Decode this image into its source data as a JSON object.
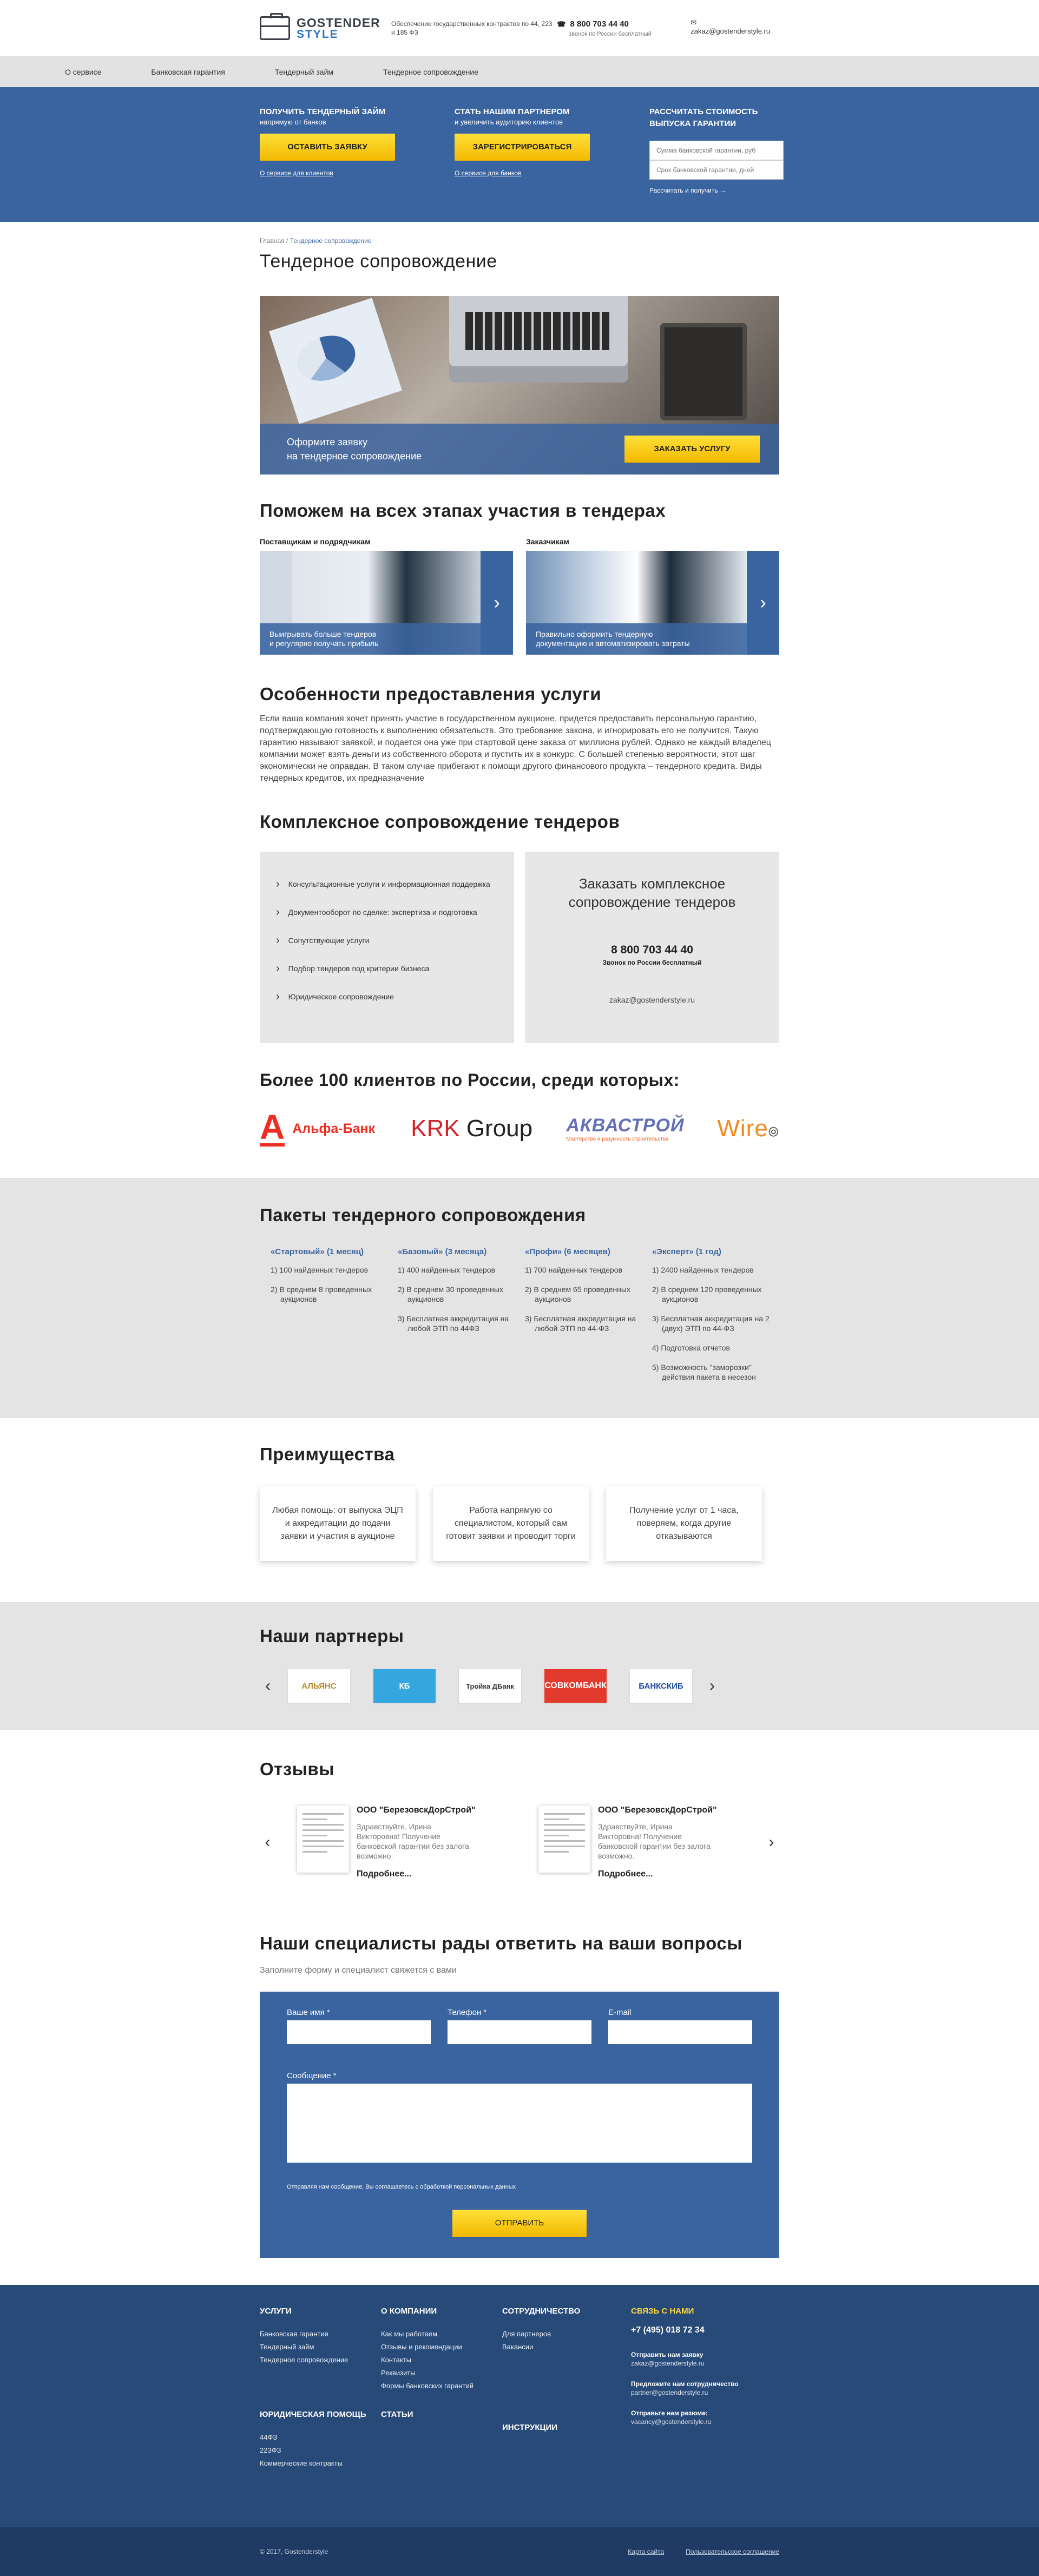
{
  "header": {
    "logo_top": "GOSTENDER",
    "logo_bottom": "STYLE",
    "desc": "Обеспечение государственных контрактов по 44, 223 и 185 ФЗ",
    "phone": "8 800 703 44 40",
    "phone_note": "звонок по России бесплатный",
    "email": "zakaz@gostenderstyle.ru"
  },
  "nav": [
    "О сервисе",
    "Банковская гарантия",
    "Тендерный займ",
    "Тендерное сопровождение"
  ],
  "promo": {
    "col1": {
      "title": "ПОЛУЧИТЬ ТЕНДЕРНЫЙ ЗАЙМ",
      "sub": "напрямую от банков",
      "button": "ОСТАВИТЬ ЗАЯВКУ",
      "link": "О сервисе для клиентов"
    },
    "col2": {
      "title": "СТАТЬ НАШИМ ПАРТНЕРОМ",
      "sub": "и увеличить аудиторию клиентов",
      "button": "ЗАРЕГИСТРИРОВАТЬСЯ",
      "link": "О сервисе для банков"
    },
    "calc": {
      "title": "РАССЧИТАТЬ СТОИМОСТЬ ВЫПУСКА ГАРАНТИИ",
      "ph1": "Сумма банковской гарантии, руб",
      "ph2": "Срок банковской гарантии, дней",
      "go": "Рассчитать и получить →"
    }
  },
  "breadcrumb": {
    "home": "Главная",
    "sep": "/",
    "current": "Тендерное сопровождение"
  },
  "page_title": "Тендерное сопровождение",
  "hero": {
    "line1": "Оформите заявку",
    "line2": "на тендерное сопровождение",
    "button": "ЗАКАЗАТЬ УСЛУГУ"
  },
  "stages": {
    "title": "Поможем на всех этапах участия в тендерах",
    "a": {
      "label": "Поставщикам и подрядчикам",
      "cap1": "Выигрывать больше тендеров",
      "cap2": "и регулярно получать прибыль"
    },
    "b": {
      "label": "Заказчикам",
      "cap1": "Правильно оформить тендерную",
      "cap2": "документацию и автоматизировать затраты"
    }
  },
  "features": {
    "title": "Особенности предоставления услуги",
    "text": "Если ваша компания хочет принять участие в государственном аукционе, придется предоставить персональную гарантию, подтверждающую готовность к выполнению обязательств. Это требование закона, и игнорировать его не получится. Такую гарантию называют заявкой, и подается она уже при стартовой цене заказа от миллиона рублей. Однако не каждый владелец компании может взять деньги из собственного оборота и пустить их в конкурс. С большей степенью вероятности, этот шаг экономически не оправдан. В таком случае прибегают к помощи другого финансового продукта – тендерного кредита. Виды тендерных кредитов, их предназначение"
  },
  "complex": {
    "title": "Комплексное сопровождение тендеров",
    "items": [
      "Консультационные услуги и информационная поддержка",
      "Документооборот по сделке: экспертиза и подготовка",
      "Сопутствующие услуги",
      "Подбор тендеров под критерии бизнеса",
      "Юридическое сопровождение"
    ],
    "order_title1": "Заказать комплексное",
    "order_title2": "сопровождение тендеров",
    "phone": "8 800 703 44 40",
    "phone_note": "Звонок по России бесплатный",
    "email": "zakaz@gostenderstyle.ru"
  },
  "clients": {
    "title": "Более 100 клиентов по России, среди которых:",
    "alfa_letter": "А",
    "alfa_word": "Альфа-Банк",
    "krk1": "KRK",
    "krk2": " Group",
    "akv": "АКВАСТРОЙ",
    "akv_sub": "Мастерство и разумность строительства",
    "wire": "Wire"
  },
  "packages": {
    "title": "Пакеты тендерного сопровождения",
    "list": [
      {
        "name": "«Стартовый» (1 месяц)",
        "items": [
          "1) 100 найденных тендеров",
          "2) В среднем 8 проведенных аукционов"
        ]
      },
      {
        "name": "«Базовый» (3 месяца)",
        "items": [
          "1) 400 найденных тендеров",
          "2) В среднем 30 проведенных аукционов",
          "3) Бесплатная аккредитация на любой ЭТП по 44ФЗ"
        ]
      },
      {
        "name": "«Профи» (6 месяцев)",
        "items": [
          "1) 700 найденных тендеров",
          "2) В среднем 65 проведенных аукционов",
          "3) Бесплатная аккредитация на любой ЭТП по 44-ФЗ"
        ]
      },
      {
        "name": "«Эксперт» (1 год)",
        "items": [
          "1) 2400 найденных тендеров",
          "2) В среднем 120 проведенных аукционов",
          "3) Бесплатная аккредитация на 2 (двух) ЭТП по 44-ФЗ",
          "4) Подготовка отчетов",
          "5) Возможность \"заморозки\" действия пакета в несезон"
        ]
      }
    ]
  },
  "advantages": {
    "title": "Преимущества",
    "items": [
      "Любая помощь: от выпуска ЭЦП и аккредитации до подачи заявки и участия в аукционе",
      "Работа напрямую со специалистом, который сам готовит заявки и проводит торги",
      "Получение услуг от 1 часа, поверяем, когда другие отказываются"
    ]
  },
  "partners": {
    "title": "Наши партнеры",
    "items": [
      "АЛЬЯНС",
      "КБ",
      "Тройка ДБанк",
      "СОВКОМБАНК",
      "БАНКСКИБ"
    ],
    "prev": "‹",
    "next": "›"
  },
  "reviews": {
    "title": "Отзывы",
    "items": [
      {
        "company": "ООО \"БерезовскДорСтрой\"",
        "text": "Здравствуйте, Ирина Викторовна! Получение банковской гарантии без залога возможно.",
        "more": "Подробнее..."
      },
      {
        "company": "ООО \"БерезовскДорСтрой\"",
        "text": "Здравствуйте, Ирина Викторовна! Получение банковской гарантии без залога возможно.",
        "more": "Подробнее..."
      }
    ],
    "prev": "‹",
    "next": "›"
  },
  "form": {
    "title": "Наши специалисты рады ответить на ваши вопросы",
    "sub": "Заполните форму и специалист свяжется с вами",
    "name": "Ваше имя *",
    "phone": "Телефон *",
    "email": "E-mail",
    "message": "Сообщение *",
    "note": "Отправляя нам сообщение, Вы соглашаетесь с обработкой персональных данных",
    "submit": "ОТПРАВИТЬ"
  },
  "footer": {
    "services": {
      "title": "УСЛУГИ",
      "items": [
        "Банковская гарантия",
        "Тендерный займ",
        "Тендерное сопровождение"
      ]
    },
    "company": {
      "title": "О КОМПАНИИ",
      "items": [
        "Как мы работаем",
        "Отзывы и рекомендации",
        "Контакты",
        "Реквизиты",
        "Формы банковских гарантий"
      ]
    },
    "coop": {
      "title": "СОТРУДНИЧЕСТВО",
      "items": [
        "Для партнеров",
        "Вакансии"
      ]
    },
    "contact": {
      "title": "СВЯЗЬ С НАМИ",
      "phone": "+7 (495) 018 72 34",
      "c1": "Отправить нам заявку",
      "e1": "zakaz@gostenderstyle.ru",
      "c2": "Предложите нам сотрудничество",
      "e2": "partner@gostenderstyle.ru",
      "c3": "Отправьте нам резюме:",
      "e3": "vacancy@gostenderstyle.ru"
    },
    "legal": {
      "title": "ЮРИДИЧЕСКАЯ ПОМОЩЬ",
      "items": [
        "44ФЗ",
        "223ФЗ",
        "Коммерческие контракты"
      ]
    },
    "articles": "СТАТЬИ",
    "instructions": "ИНСТРУКЦИИ",
    "copyright": "© 2017, Gostenderstyle",
    "sitemap": "Карта сайта",
    "agreement": "Пользовательское соглашение"
  }
}
